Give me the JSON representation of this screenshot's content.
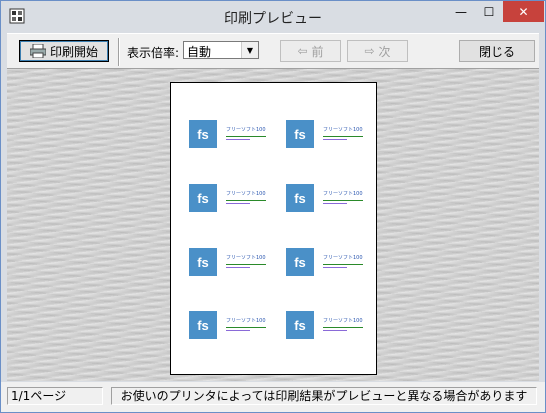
{
  "window": {
    "title": "印刷プレビュー",
    "minimize": "—",
    "maximize": "☐",
    "close": "✕"
  },
  "toolbar": {
    "print_label": "印刷開始",
    "zoom_label": "表示倍率:",
    "zoom_value": "自動",
    "prev_label": "前",
    "next_label": "次",
    "close_label": "閉じる"
  },
  "labels": [
    {
      "logo": "fs",
      "text": "フリーソフト100"
    },
    {
      "logo": "fs",
      "text": "フリーソフト100"
    },
    {
      "logo": "fs",
      "text": "フリーソフト100"
    },
    {
      "logo": "fs",
      "text": "フリーソフト100"
    },
    {
      "logo": "fs",
      "text": "フリーソフト100"
    },
    {
      "logo": "fs",
      "text": "フリーソフト100"
    },
    {
      "logo": "fs",
      "text": "フリーソフト100"
    },
    {
      "logo": "fs",
      "text": "フリーソフト100"
    }
  ],
  "status": {
    "page": "1/1ページ",
    "message": "お使いのプリンタによっては印刷結果がプレビューと異なる場合があります"
  },
  "colors": {
    "accent": "#4a90c8",
    "close_button": "#c7423c"
  }
}
